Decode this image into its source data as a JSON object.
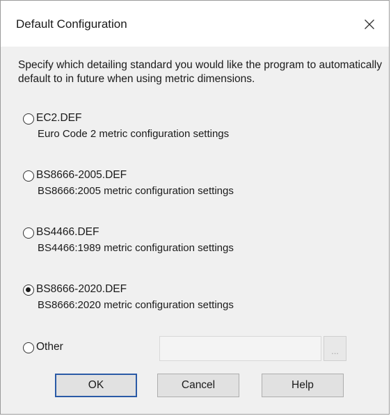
{
  "dialog": {
    "title": "Default Configuration",
    "description": "Specify which detailing standard you would like the program to automatically default to in future when using metric dimensions."
  },
  "options": [
    {
      "label": "EC2.DEF",
      "description": "Euro Code 2 metric configuration settings",
      "selected": false
    },
    {
      "label": "BS8666-2005.DEF",
      "description": "BS8666:2005 metric configuration settings",
      "selected": false
    },
    {
      "label": "BS4466.DEF",
      "description": "BS4466:1989 metric configuration settings",
      "selected": false
    },
    {
      "label": "BS8666-2020.DEF",
      "description": "BS8666:2020 metric configuration settings",
      "selected": true
    }
  ],
  "other": {
    "label": "Other",
    "value": "",
    "browse_label": "...",
    "selected": false,
    "disabled": true
  },
  "buttons": {
    "ok": "OK",
    "cancel": "Cancel",
    "help": "Help"
  },
  "icons": {
    "close": "close-icon"
  }
}
